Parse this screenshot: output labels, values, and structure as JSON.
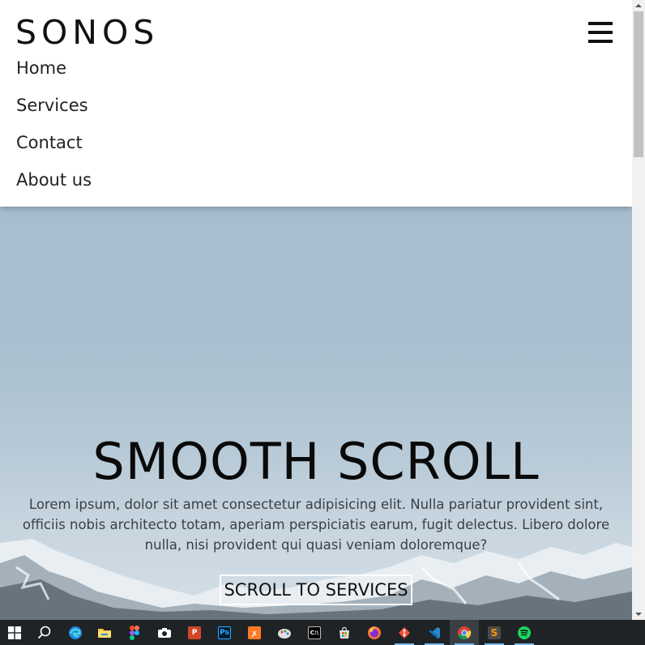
{
  "navbar": {
    "logo": "SONOS",
    "menu_icon": "hamburger-menu-icon",
    "items": [
      {
        "label": "Home"
      },
      {
        "label": "Services"
      },
      {
        "label": "Contact"
      },
      {
        "label": "About us"
      }
    ]
  },
  "hero": {
    "title": "SMOOTH SCROLL",
    "text": "Lorem ipsum, dolor sit amet consectetur adipisicing elit. Nulla pariatur provident sint, officiis nobis architecto totam, aperiam perspiciatis earum, fugit delectus. Libero dolore nulla, nisi provident qui quasi veniam doloremque?",
    "button_label": "SCROLL TO SERVICES",
    "colors": {
      "sky": "#a9c0cf",
      "text": "#0a0a0a"
    }
  },
  "taskbar": {
    "items": [
      {
        "icon": "windows-start-icon"
      },
      {
        "icon": "search-icon"
      },
      {
        "icon": "edge-browser-icon"
      },
      {
        "icon": "file-explorer-icon"
      },
      {
        "icon": "figma-icon"
      },
      {
        "icon": "camera-icon"
      },
      {
        "icon": "powerpoint-icon"
      },
      {
        "icon": "photoshop-icon",
        "text": "Ps"
      },
      {
        "icon": "xampp-icon"
      },
      {
        "icon": "paint-icon"
      },
      {
        "icon": "terminal-icon",
        "text": "C:\\"
      },
      {
        "icon": "store-icon"
      },
      {
        "icon": "firefox-icon"
      },
      {
        "icon": "git-icon"
      },
      {
        "icon": "vscode-icon"
      },
      {
        "icon": "chrome-icon"
      },
      {
        "icon": "sublime-text-icon"
      },
      {
        "icon": "spotify-icon"
      }
    ]
  }
}
